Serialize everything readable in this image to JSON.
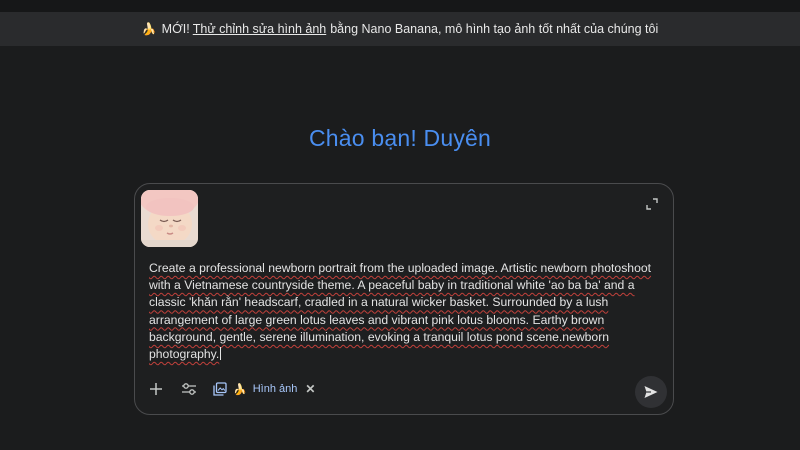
{
  "banner": {
    "emoji": "🍌",
    "prefix": "MỚI!",
    "link_text": "Thử chỉnh sửa hình ảnh",
    "suffix": "bằng Nano Banana, mô hình tạo ảnh tốt nhất của chúng tôi"
  },
  "greeting": "Chào bạn! Duyên",
  "composer": {
    "prompt_text": "Create a professional newborn portrait from the uploaded image. Artistic newborn photoshoot with a Vietnamese countryside theme. A peaceful baby in traditional white 'ao ba ba' and a classic 'khăn rằn' headscarf, cradled in a natural wicker basket. Surrounded by a lush arrangement of large green lotus leaves and vibrant pink lotus blooms. Earthy brown background, gentle, serene illumination, evoking a tranquil lotus pond scene.newborn photography."
  },
  "toolbar": {
    "chip_emoji": "🍌",
    "chip_label": "Hình ảnh",
    "chip_close": "✕"
  },
  "colors": {
    "accent": "#4a8ef0",
    "chip": "#a8c7fa",
    "background": "#1b1c1d",
    "banner": "#2a2b2d"
  },
  "icons": [
    "expand-icon",
    "plus-icon",
    "tune-icon",
    "gallery-icon",
    "banana-icon",
    "close-icon",
    "send-icon"
  ]
}
